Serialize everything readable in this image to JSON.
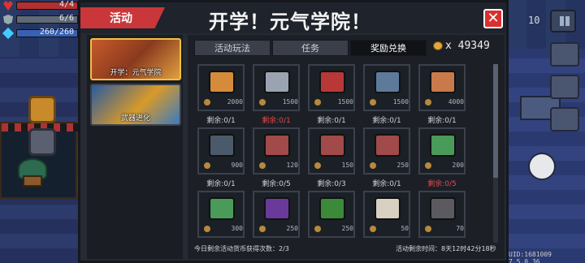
{
  "hud": {
    "hp": "4/4",
    "armor": "6/6",
    "energy": "260/260",
    "time": "10"
  },
  "footer": {
    "uid_version": "UID:1681009  7.5.0.36"
  },
  "modal": {
    "category_label": "活动",
    "title": "开学！元气学院！",
    "close_label": "✕",
    "events": [
      {
        "label": "开学：元气学院",
        "active": true
      },
      {
        "label": "武器进化",
        "active": false
      }
    ],
    "subtabs": [
      {
        "label": "活动玩法",
        "active": false
      },
      {
        "label": "任务",
        "active": false
      },
      {
        "label": "奖励兑换",
        "active": true
      }
    ],
    "currency_amount": "49349",
    "currency_prefix": "x",
    "items": [
      {
        "icon": "palette-icon",
        "price": "2000",
        "remain": "剩余:0/1",
        "red": false,
        "color": "#d68b3a"
      },
      {
        "icon": "stick-icon",
        "price": "1500",
        "remain": "剩余:0/1",
        "red": true,
        "color": "#9aa3b0"
      },
      {
        "icon": "book-icon",
        "price": "1500",
        "remain": "剩余:0/1",
        "red": false,
        "color": "#b83838"
      },
      {
        "icon": "device-icon",
        "price": "1500",
        "remain": "剩余:0/1",
        "red": false,
        "color": "#5e7a9a"
      },
      {
        "icon": "character-icon",
        "price": "4000",
        "remain": "剩余:0/1",
        "red": false,
        "color": "#c87a4a"
      },
      {
        "icon": "orb-icon",
        "price": "900",
        "remain": "剩余:0/1",
        "red": false,
        "color": "#4a5a6a"
      },
      {
        "icon": "ticket-red-icon",
        "price": "120",
        "remain": "剩余:0/5",
        "red": false,
        "color": "#a04a4a"
      },
      {
        "icon": "ticket-red-icon",
        "price": "150",
        "remain": "剩余:0/3",
        "red": false,
        "color": "#a04a4a"
      },
      {
        "icon": "ticket-red-icon",
        "price": "250",
        "remain": "剩余:0/1",
        "red": false,
        "color": "#a04a4a"
      },
      {
        "icon": "ticket-green-icon",
        "price": "200",
        "remain": "剩余:0/5",
        "red": true,
        "color": "#4a9a5a"
      },
      {
        "icon": "ticket-green-icon",
        "price": "300",
        "remain": "",
        "red": false,
        "color": "#4a9a5a"
      },
      {
        "icon": "eggplant-icon",
        "price": "250",
        "remain": "",
        "red": false,
        "color": "#6a3a9a"
      },
      {
        "icon": "watermelon-icon",
        "price": "250",
        "remain": "",
        "red": false,
        "color": "#3a8a3a"
      },
      {
        "icon": "bag-icon",
        "price": "50",
        "remain": "",
        "red": false,
        "color": "#d8d0c0"
      },
      {
        "icon": "ore-icon",
        "price": "70",
        "remain": "",
        "red": false,
        "color": "#5a5a60"
      }
    ],
    "footer_left": "今日剩余活动货币获得次数：2/3",
    "footer_right": "活动剩余时间：8天12时42分18秒"
  }
}
